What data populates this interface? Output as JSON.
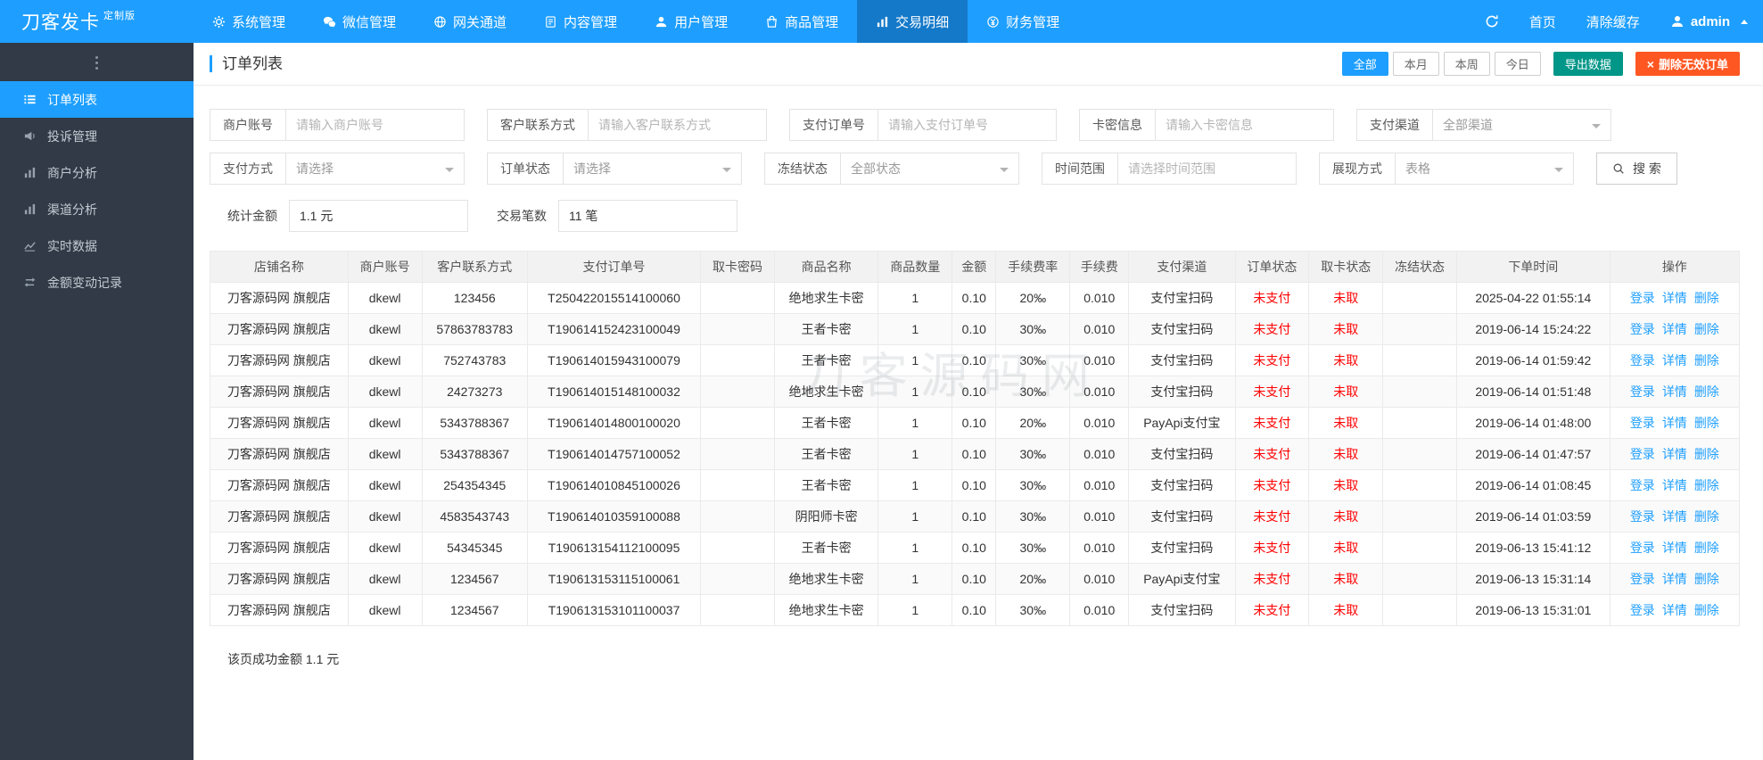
{
  "topbar": {
    "logo": "刀客发卡",
    "badge": "定制版",
    "nav": [
      {
        "name": "system",
        "icon": "gear",
        "label": "系统管理",
        "active": false
      },
      {
        "name": "wechat",
        "icon": "wechat",
        "label": "微信管理",
        "active": false
      },
      {
        "name": "gateway",
        "icon": "globe",
        "label": "网关通道",
        "active": false
      },
      {
        "name": "content",
        "icon": "doc",
        "label": "内容管理",
        "active": false
      },
      {
        "name": "users",
        "icon": "user",
        "label": "用户管理",
        "active": false
      },
      {
        "name": "goods",
        "icon": "bag",
        "label": "商品管理",
        "active": false
      },
      {
        "name": "trades",
        "icon": "chart",
        "label": "交易明细",
        "active": true
      },
      {
        "name": "finance",
        "icon": "finance",
        "label": "财务管理",
        "active": false
      }
    ],
    "home": "首页",
    "clear_cache": "清除缓存",
    "user": "admin"
  },
  "sidebar": {
    "items": [
      {
        "name": "orders",
        "icon": "list",
        "label": "订单列表",
        "active": true
      },
      {
        "name": "complaints",
        "icon": "horn",
        "label": "投诉管理",
        "active": false
      },
      {
        "name": "merchant-analysis",
        "icon": "chart-bar",
        "label": "商户分析",
        "active": false
      },
      {
        "name": "channel-analysis",
        "icon": "chart-bar",
        "label": "渠道分析",
        "active": false
      },
      {
        "name": "realtime-data",
        "icon": "chart-line",
        "label": "实时数据",
        "active": false
      },
      {
        "name": "balance-log",
        "icon": "exchange",
        "label": "金额变动记录",
        "active": false
      }
    ]
  },
  "main": {
    "title": "订单列表",
    "range_buttons": [
      {
        "name": "all",
        "label": "全部",
        "active": true
      },
      {
        "name": "month",
        "label": "本月",
        "active": false
      },
      {
        "name": "week",
        "label": "本周",
        "active": false
      },
      {
        "name": "today",
        "label": "今日",
        "active": false
      }
    ],
    "export_label": "导出数据",
    "delete_invalid_label": "删除无效订单",
    "filters": [
      {
        "name": "merchant-account",
        "label": "商户账号",
        "type": "input",
        "placeholder": "请输入商户账号"
      },
      {
        "name": "customer-contact",
        "label": "客户联系方式",
        "type": "input",
        "placeholder": "请输入客户联系方式"
      },
      {
        "name": "payment-order-no",
        "label": "支付订单号",
        "type": "input",
        "placeholder": "请输入支付订单号"
      },
      {
        "name": "card-info",
        "label": "卡密信息",
        "type": "input",
        "placeholder": "请输入卡密信息"
      },
      {
        "name": "payment-channel",
        "label": "支付渠道",
        "type": "select",
        "value": "全部渠道"
      },
      {
        "name": "payment-method",
        "label": "支付方式",
        "type": "select",
        "value": "请选择"
      },
      {
        "name": "order-status",
        "label": "订单状态",
        "type": "select",
        "value": "请选择"
      },
      {
        "name": "freeze-status",
        "label": "冻结状态",
        "type": "select",
        "value": "全部状态"
      },
      {
        "name": "time-range",
        "label": "时间范围",
        "type": "input",
        "placeholder": "请选择时间范围"
      },
      {
        "name": "display-mode",
        "label": "展现方式",
        "type": "select",
        "value": "表格"
      }
    ],
    "search_label": "搜 索",
    "stats": [
      {
        "label": "统计金额",
        "value": "1.1 元"
      },
      {
        "label": "交易笔数",
        "value": "11 笔"
      }
    ],
    "watermark": "刀客源码网",
    "table": {
      "headers": [
        "店铺名称",
        "商户账号",
        "客户联系方式",
        "支付订单号",
        "取卡密码",
        "商品名称",
        "商品数量",
        "金额",
        "手续费率",
        "手续费",
        "支付渠道",
        "订单状态",
        "取卡状态",
        "冻结状态",
        "下单时间",
        "操作"
      ],
      "actions": [
        {
          "name": "login",
          "label": "登录"
        },
        {
          "name": "detail",
          "label": "详情"
        },
        {
          "name": "delete",
          "label": "删除"
        }
      ],
      "rows": [
        [
          "刀客源码网 旗舰店",
          "dkewl",
          "123456",
          "T250422015514100060",
          "",
          "绝地求生卡密",
          "1",
          "0.10",
          "20‰",
          "0.010",
          "支付宝扫码",
          "未支付",
          "未取",
          "",
          "2025-04-22 01:55:14"
        ],
        [
          "刀客源码网 旗舰店",
          "dkewl",
          "57863783783",
          "T190614152423100049",
          "",
          "王者卡密",
          "1",
          "0.10",
          "30‰",
          "0.010",
          "支付宝扫码",
          "未支付",
          "未取",
          "",
          "2019-06-14 15:24:22"
        ],
        [
          "刀客源码网 旗舰店",
          "dkewl",
          "752743783",
          "T190614015943100079",
          "",
          "王者卡密",
          "1",
          "0.10",
          "30‰",
          "0.010",
          "支付宝扫码",
          "未支付",
          "未取",
          "",
          "2019-06-14 01:59:42"
        ],
        [
          "刀客源码网 旗舰店",
          "dkewl",
          "24273273",
          "T190614015148100032",
          "",
          "绝地求生卡密",
          "1",
          "0.10",
          "30‰",
          "0.010",
          "支付宝扫码",
          "未支付",
          "未取",
          "",
          "2019-06-14 01:51:48"
        ],
        [
          "刀客源码网 旗舰店",
          "dkewl",
          "5343788367",
          "T190614014800100020",
          "",
          "王者卡密",
          "1",
          "0.10",
          "20‰",
          "0.010",
          "PayApi支付宝",
          "未支付",
          "未取",
          "",
          "2019-06-14 01:48:00"
        ],
        [
          "刀客源码网 旗舰店",
          "dkewl",
          "5343788367",
          "T190614014757100052",
          "",
          "王者卡密",
          "1",
          "0.10",
          "30‰",
          "0.010",
          "支付宝扫码",
          "未支付",
          "未取",
          "",
          "2019-06-14 01:47:57"
        ],
        [
          "刀客源码网 旗舰店",
          "dkewl",
          "254354345",
          "T190614010845100026",
          "",
          "王者卡密",
          "1",
          "0.10",
          "30‰",
          "0.010",
          "支付宝扫码",
          "未支付",
          "未取",
          "",
          "2019-06-14 01:08:45"
        ],
        [
          "刀客源码网 旗舰店",
          "dkewl",
          "4583543743",
          "T190614010359100088",
          "",
          "阴阳师卡密",
          "1",
          "0.10",
          "30‰",
          "0.010",
          "支付宝扫码",
          "未支付",
          "未取",
          "",
          "2019-06-14 01:03:59"
        ],
        [
          "刀客源码网 旗舰店",
          "dkewl",
          "54345345",
          "T190613154112100095",
          "",
          "王者卡密",
          "1",
          "0.10",
          "30‰",
          "0.010",
          "支付宝扫码",
          "未支付",
          "未取",
          "",
          "2019-06-13 15:41:12"
        ],
        [
          "刀客源码网 旗舰店",
          "dkewl",
          "1234567",
          "T190613153115100061",
          "",
          "绝地求生卡密",
          "1",
          "0.10",
          "20‰",
          "0.010",
          "PayApi支付宝",
          "未支付",
          "未取",
          "",
          "2019-06-13 15:31:14"
        ],
        [
          "刀客源码网 旗舰店",
          "dkewl",
          "1234567",
          "T190613153101100037",
          "",
          "绝地求生卡密",
          "1",
          "0.10",
          "30‰",
          "0.010",
          "支付宝扫码",
          "未支付",
          "未取",
          "",
          "2019-06-13 15:31:01"
        ]
      ]
    },
    "footer": "该页成功金额 1.1 元"
  }
}
